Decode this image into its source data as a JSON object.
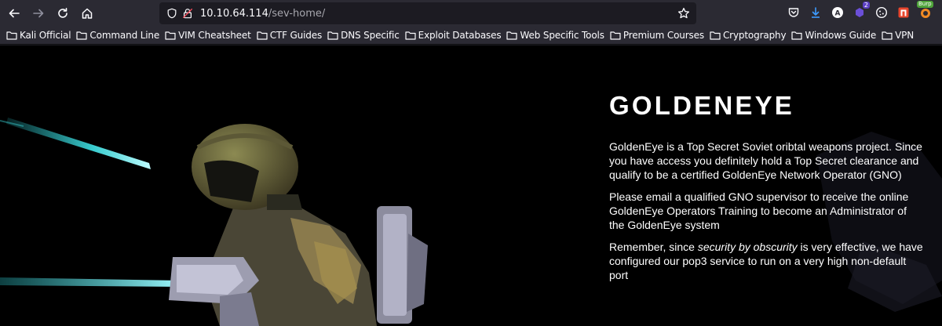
{
  "browser": {
    "url_host": "10.10.64.114",
    "url_path": "/sev-home/",
    "extensions": [
      {
        "name": "pocket-icon"
      },
      {
        "name": "download-icon"
      },
      {
        "name": "account-icon",
        "glyph": "A"
      },
      {
        "name": "extension-badge-icon",
        "badge": "2"
      },
      {
        "name": "cookie-icon"
      },
      {
        "name": "n-extension-icon"
      },
      {
        "name": "burp-icon",
        "badge": "Burp"
      }
    ]
  },
  "bookmarks": [
    "Kali Official",
    "Command Line",
    "VIM Cheatsheet",
    "CTF Guides",
    "DNS Specific",
    "Exploit Databases",
    "Web Specific Tools",
    "Premium Courses",
    "Cryptography",
    "Windows Guide",
    "VPN"
  ],
  "page": {
    "title": "GOLDENEYE",
    "para1": "GoldenEye is a Top Secret Soviet oribtal weapons project. Since you have access you definitely hold a Top Secret clearance and qualify to be a certified GoldenEye Network Operator (GNO)",
    "para2": "Please email a qualified GNO supervisor to receive the online GoldenEye Operators Training to become an Administrator of the GoldenEye system",
    "para3_before": "Remember, since ",
    "para3_em": "security by obscurity",
    "para3_after": " is very effective, we have configured our pop3 service to run on a very high non-default port"
  },
  "colors": {
    "toolbar": "#2b2a33",
    "urlbar": "#1c1b22",
    "laser": "#3fe3e6",
    "page_bg": "#000000"
  }
}
